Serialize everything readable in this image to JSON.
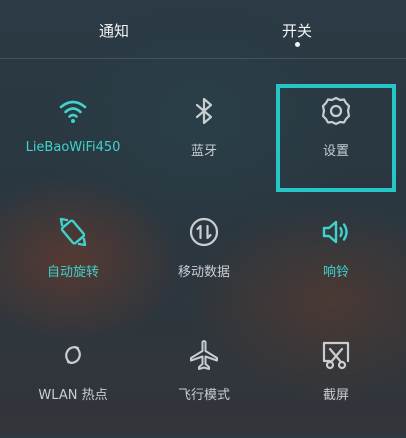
{
  "tabs": {
    "notice": "通知",
    "switch": "开关"
  },
  "tiles": [
    {
      "label": "LieBaoWiFi450",
      "icon": "wifi-icon",
      "active": true
    },
    {
      "label": "蓝牙",
      "icon": "bluetooth-icon",
      "active": false
    },
    {
      "label": "设置",
      "icon": "gear-icon",
      "active": false
    },
    {
      "label": "自动旋转",
      "icon": "auto-rotate-icon",
      "active": true
    },
    {
      "label": "移动数据",
      "icon": "mobile-data-icon",
      "active": false
    },
    {
      "label": "响铃",
      "icon": "speaker-icon",
      "active": true
    },
    {
      "label": "WLAN 热点",
      "icon": "hotspot-icon",
      "active": false
    },
    {
      "label": "飞行模式",
      "icon": "airplane-icon",
      "active": false
    },
    {
      "label": "截屏",
      "icon": "screenshot-icon",
      "active": false
    }
  ],
  "colors": {
    "accent": "#3fd3cc",
    "highlight": "#27c6c6",
    "inactive": "#c8cdd1"
  }
}
